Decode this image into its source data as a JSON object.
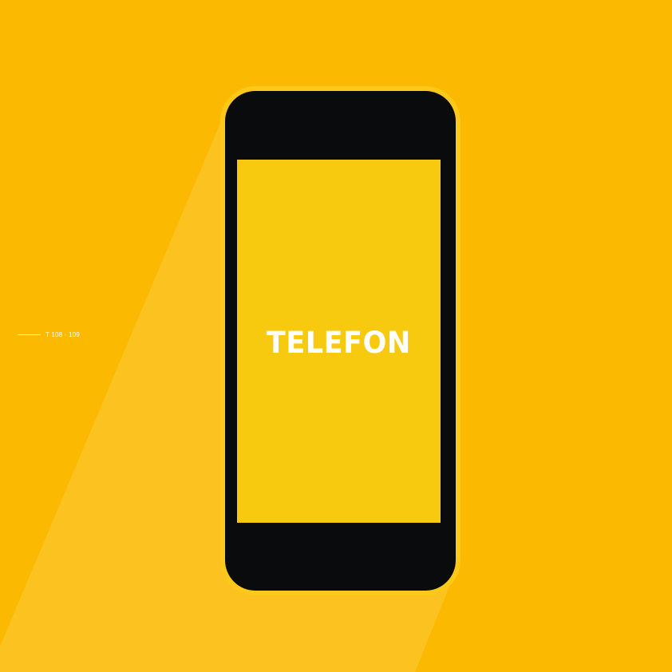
{
  "colors": {
    "background": "#FBB902",
    "light_beam": "#FCC21F",
    "phone_rim": "#FCC91A",
    "phone_body": "#0A0B0C",
    "screen": "#F7C90F",
    "text": "#FFFFFF"
  },
  "phone": {
    "screen_title": "TELEFON"
  },
  "page_reference": {
    "text": "T 108 - 109"
  }
}
